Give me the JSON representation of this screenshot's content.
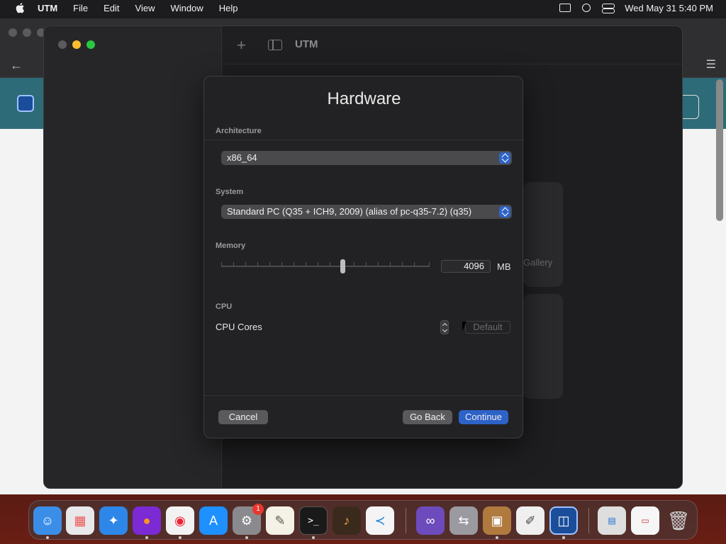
{
  "menubar": {
    "app_name": "UTM",
    "items": [
      "File",
      "Edit",
      "View",
      "Window",
      "Help"
    ],
    "datetime": "Wed May 31  5:40 PM"
  },
  "window": {
    "title": "UTM"
  },
  "background": {
    "gallery_text": "Gallery"
  },
  "sheet": {
    "title": "Hardware",
    "architecture": {
      "label": "Architecture",
      "value": "x86_64"
    },
    "system": {
      "label": "System",
      "value": "Standard PC (Q35 + ICH9, 2009) (alias of pc-q35-7.2) (q35)"
    },
    "memory": {
      "label": "Memory",
      "value": "4096",
      "unit": "MB"
    },
    "cpu": {
      "label": "CPU",
      "cores_label": "CPU Cores",
      "default_label": "Default"
    },
    "buttons": {
      "cancel": "Cancel",
      "go_back": "Go Back",
      "continue": "Continue"
    }
  },
  "dock": {
    "settings_badge": "1",
    "icons": [
      "finder-icon",
      "launchpad-icon",
      "safari-icon",
      "firefox-icon",
      "chrome-icon",
      "app-store-icon",
      "system-settings-icon",
      "textedit-icon",
      "terminal-icon",
      "garageband-icon",
      "vscode-icon",
      "visual-studio-icon",
      "migration-assistant-icon",
      "archive-utility-icon",
      "script-editor-icon",
      "utm-icon",
      "downloads-stack-icon",
      "document-stack-icon",
      "trash-icon"
    ]
  },
  "colors": {
    "accent": "#2d62c8",
    "minimize": "#febc2e",
    "maximize": "#28c840"
  }
}
